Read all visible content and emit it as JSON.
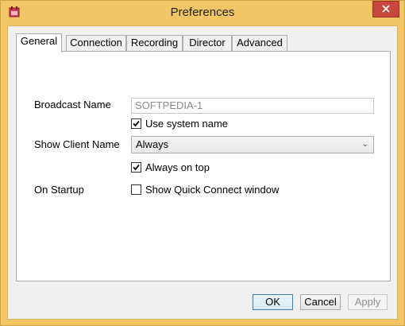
{
  "window": {
    "title": "Preferences"
  },
  "tabs": [
    {
      "label": "General"
    },
    {
      "label": "Connection"
    },
    {
      "label": "Recording"
    },
    {
      "label": "Director"
    },
    {
      "label": "Advanced"
    }
  ],
  "general": {
    "broadcast_name_label": "Broadcast Name",
    "broadcast_name_value": "SOFTPEDIA-1",
    "use_system_name_label": "Use system name",
    "use_system_name_checked": true,
    "show_client_name_label": "Show Client Name",
    "show_client_name_value": "Always",
    "always_on_top_label": "Always on top",
    "always_on_top_checked": true,
    "on_startup_label": "On Startup",
    "show_quick_connect_label": "Show Quick Connect window",
    "show_quick_connect_checked": false
  },
  "buttons": {
    "ok": "OK",
    "cancel": "Cancel",
    "apply": "Apply"
  },
  "colors": {
    "frame": "#f2c664",
    "close": "#c7473f",
    "default_button_border": "#3c7fb1"
  }
}
